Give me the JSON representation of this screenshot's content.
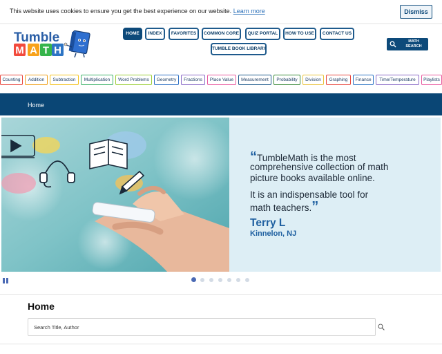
{
  "cookie": {
    "message": "This website uses cookies to ensure you get the best experience on our website.",
    "learn_more": "Learn more",
    "dismiss": "Dismiss"
  },
  "brand": {
    "logo_top": "Tumble",
    "logo_bottom": "MATH",
    "logo_letter_colors": [
      "#f24a3c",
      "#f8a21a",
      "#35b44a",
      "#2d74c4"
    ]
  },
  "nav": {
    "items": [
      "HOME",
      "INDEX",
      "FAVORITES",
      "COMMON CORE",
      "QUIZ PORTAL",
      "HOW TO USE",
      "CONTACT US",
      "TUMBLE BOOK LIBRARY"
    ],
    "active": "HOME"
  },
  "math_search": {
    "label": "MATH SEARCH",
    "icon": "search-icon"
  },
  "topics": [
    {
      "label": "Counting",
      "color": "#e8483f"
    },
    {
      "label": "Addition",
      "color": "#f0a11d"
    },
    {
      "label": "Subtraction",
      "color": "#f4c21b"
    },
    {
      "label": "Multiplication",
      "color": "#3fb36a"
    },
    {
      "label": "Word Problems",
      "color": "#9ccf3a"
    },
    {
      "label": "Geometry",
      "color": "#2d6fc4"
    },
    {
      "label": "Fractions",
      "color": "#8a6ac7"
    },
    {
      "label": "Place Value",
      "color": "#e85aa0"
    },
    {
      "label": "Measurement",
      "color": "#1e5a8c"
    },
    {
      "label": "Probability",
      "color": "#3a8a3a"
    },
    {
      "label": "Division",
      "color": "#e8c23a"
    },
    {
      "label": "Graphing",
      "color": "#e8483f"
    },
    {
      "label": "Finance",
      "color": "#2d74c4"
    },
    {
      "label": "Time/Temperature",
      "color": "#8a6ac7"
    },
    {
      "label": "Playlists",
      "color": "#e85aa0"
    }
  ],
  "breadcrumb": "Home",
  "testimonial": {
    "line1": "TumbleMath is the most",
    "line2": "comprehensive collection of math",
    "line3": "picture books available online.",
    "line4": "It is an indispensable tool for",
    "line5": "math teachers.",
    "open_quote": "“",
    "close_quote": "”",
    "author": "Terry L",
    "location": "Kinnelon, NJ"
  },
  "carousel": {
    "slides": 7,
    "active_index": 0
  },
  "section": {
    "title": "Home",
    "search_placeholder": "Search Title, Author"
  },
  "colors": {
    "navy": "#0a4675",
    "quote_blue": "#1e5fa0",
    "hero_bg": "#ddeef5"
  }
}
